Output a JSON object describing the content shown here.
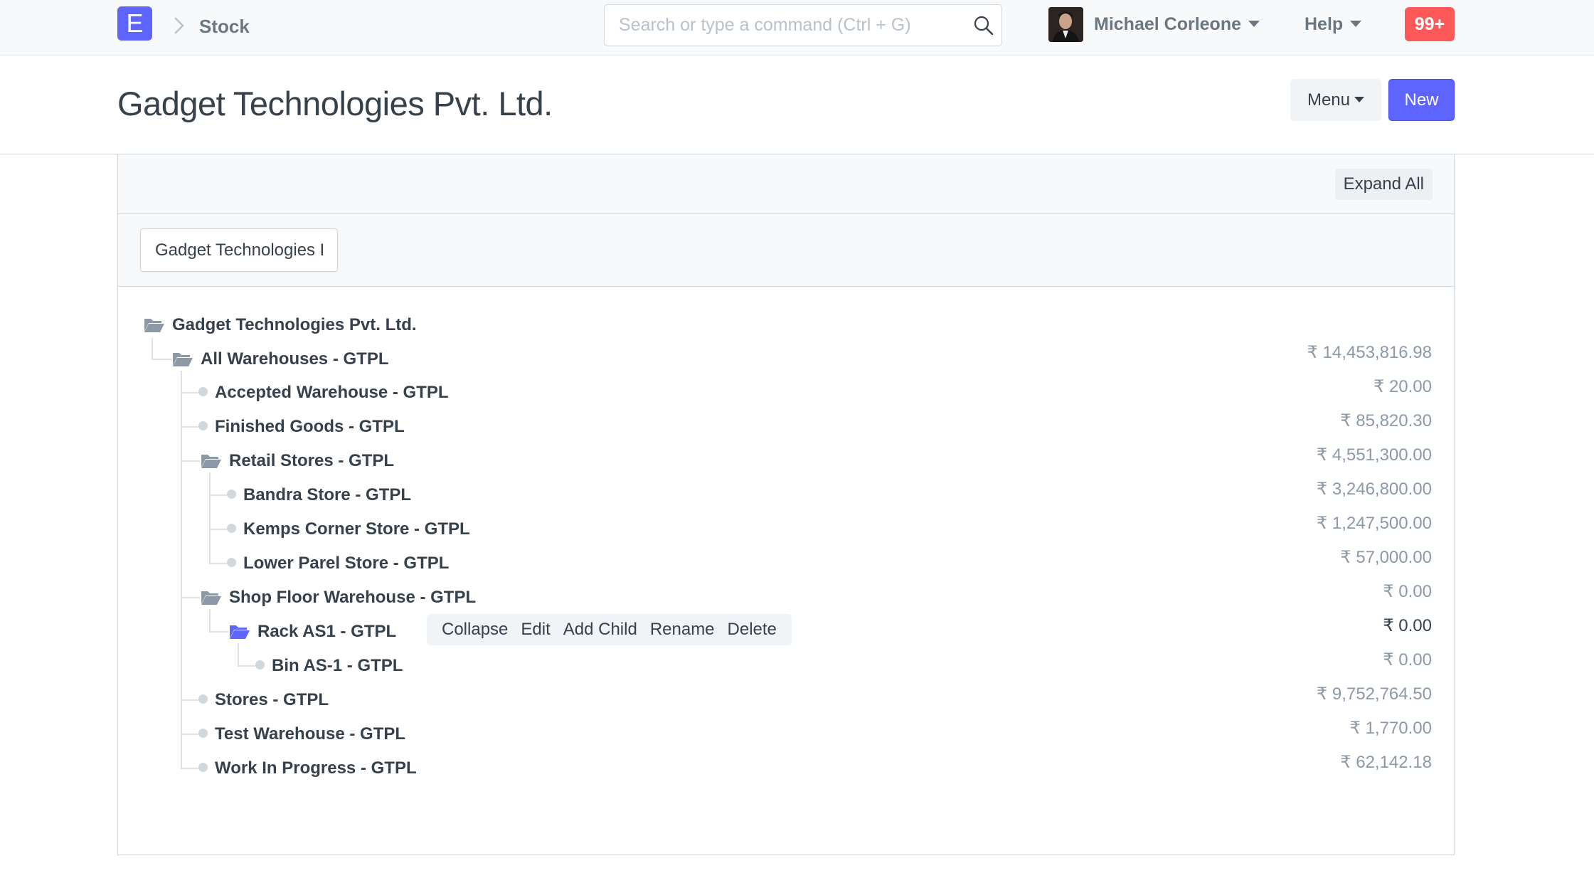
{
  "navbar": {
    "brand": "E",
    "breadcrumb": "Stock",
    "search_placeholder": "Search or type a command (Ctrl + G)",
    "user_name": "Michael Corleone",
    "help_label": "Help",
    "notification_count": "99+"
  },
  "page": {
    "title": "Gadget Technologies Pvt. Ltd.",
    "menu_label": "Menu",
    "new_label": "New"
  },
  "toolbar": {
    "expand_all": "Expand All"
  },
  "filter": {
    "company_value": "Gadget Technologies Pvt. Ltd."
  },
  "tree": {
    "root": "Gadget Technologies Pvt. Ltd.",
    "nodes": [
      {
        "label": "All Warehouses - GTPL",
        "balance": "₹ 14,453,816.98"
      },
      {
        "label": "Accepted Warehouse - GTPL",
        "balance": "₹ 20.00"
      },
      {
        "label": "Finished Goods - GTPL",
        "balance": "₹ 85,820.30"
      },
      {
        "label": "Retail Stores - GTPL",
        "balance": "₹ 4,551,300.00"
      },
      {
        "label": "Bandra Store - GTPL",
        "balance": "₹ 3,246,800.00"
      },
      {
        "label": "Kemps Corner Store - GTPL",
        "balance": "₹ 1,247,500.00"
      },
      {
        "label": "Lower Parel Store - GTPL",
        "balance": "₹ 57,000.00"
      },
      {
        "label": "Shop Floor Warehouse - GTPL",
        "balance": "₹ 0.00"
      },
      {
        "label": "Rack AS1 - GTPL",
        "balance": "₹ 0.00"
      },
      {
        "label": "Bin AS-1 - GTPL",
        "balance": "₹ 0.00"
      },
      {
        "label": "Stores - GTPL",
        "balance": "₹ 9,752,764.50"
      },
      {
        "label": "Test Warehouse - GTPL",
        "balance": "₹ 1,770.00"
      },
      {
        "label": "Work In Progress - GTPL",
        "balance": "₹ 62,142.18"
      }
    ],
    "actions": [
      "Collapse",
      "Edit",
      "Add Child",
      "Rename",
      "Delete"
    ]
  },
  "colors": {
    "primary": "#5e64ff",
    "notification": "#ff5858",
    "folder_grey": "#8d99a6",
    "text": "#36414c"
  }
}
